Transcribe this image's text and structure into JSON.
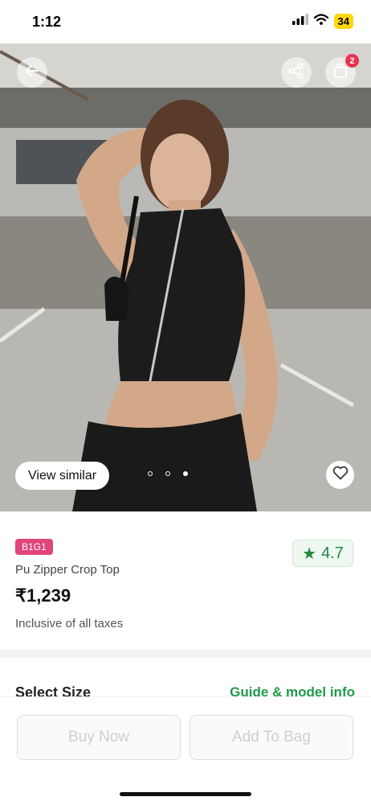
{
  "status_bar": {
    "time": "1:12",
    "battery": "34"
  },
  "header": {
    "cart_count": "2"
  },
  "hero": {
    "view_similar_label": "View similar",
    "carousel_pages": 3,
    "active_page": 0
  },
  "product": {
    "offer_badge": "B1G1",
    "name": "Pu Zipper Crop Top",
    "price": "₹1,239",
    "tax_note": "Inclusive of all taxes",
    "rating": "4.7"
  },
  "size_section": {
    "title": "Select Size",
    "guide_link": "Guide & model info"
  },
  "actions": {
    "buy_now": "Buy Now",
    "add_to_bag": "Add To Bag"
  },
  "colors": {
    "accent_green": "#1f9a4a",
    "badge_pink": "#e0457b",
    "cart_red": "#e8344e"
  }
}
